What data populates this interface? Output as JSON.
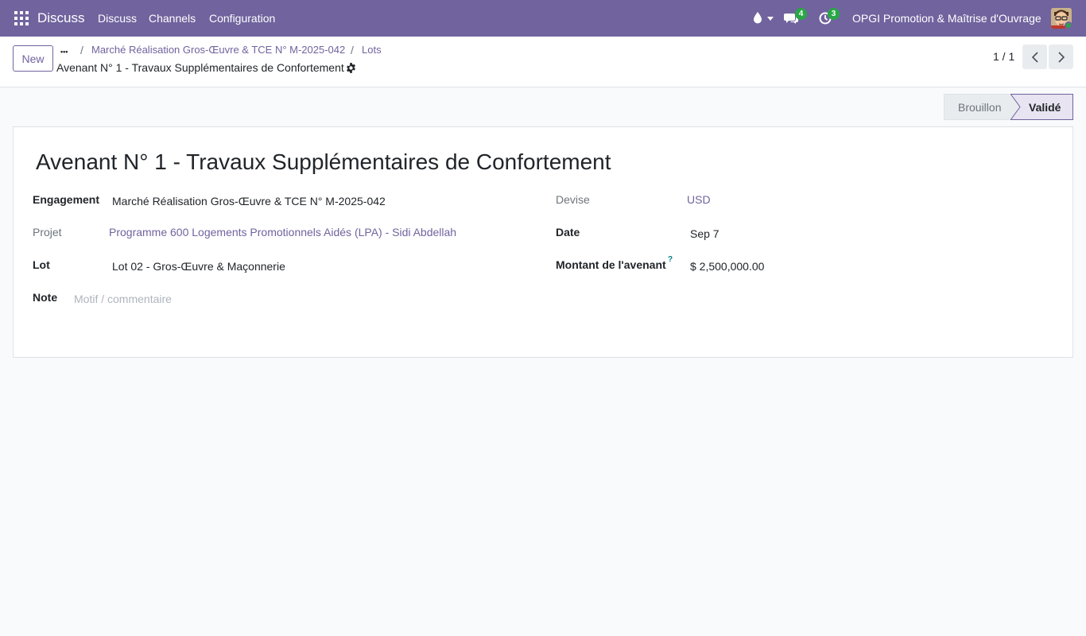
{
  "navbar": {
    "app_name": "Discuss",
    "menu": [
      "Discuss",
      "Channels",
      "Configuration"
    ],
    "messages_badge": "4",
    "activities_badge": "3",
    "company": "OPGI Promotion & Maîtrise d'Ouvrage"
  },
  "control_panel": {
    "new_label": "New",
    "more_label": "•••",
    "breadcrumb": [
      "Marché Réalisation Gros-Œuvre & TCE N° M-2025-042",
      "Lots"
    ],
    "record_title": "Avenant N° 1 - Travaux Supplémentaires de Confortement",
    "pager": "1 / 1"
  },
  "statusbar": {
    "stages": [
      "Brouillon",
      "Validé"
    ],
    "active": "Validé"
  },
  "form": {
    "title": "Avenant N° 1 - Travaux Supplémentaires de Confortement",
    "engagement_label": "Engagement",
    "engagement_value": "Marché Réalisation Gros-Œuvre & TCE N° M-2025-042",
    "projet_label": "Projet",
    "projet_value": "Programme 600 Logements Promotionnels Aidés (LPA) - Sidi Abdellah",
    "lot_label": "Lot",
    "lot_value": "Lot 02 - Gros-Œuvre & Maçonnerie",
    "note_label": "Note",
    "note_placeholder": "Motif / commentaire",
    "devise_label": "Devise",
    "devise_value": "USD",
    "date_label": "Date",
    "date_value": "Sep 7",
    "montant_label": "Montant de l'avenant",
    "montant_help": "?",
    "montant_value": "$ 2,500,000.00"
  },
  "colors": {
    "brand": "#71639e",
    "badge": "#28a745"
  }
}
